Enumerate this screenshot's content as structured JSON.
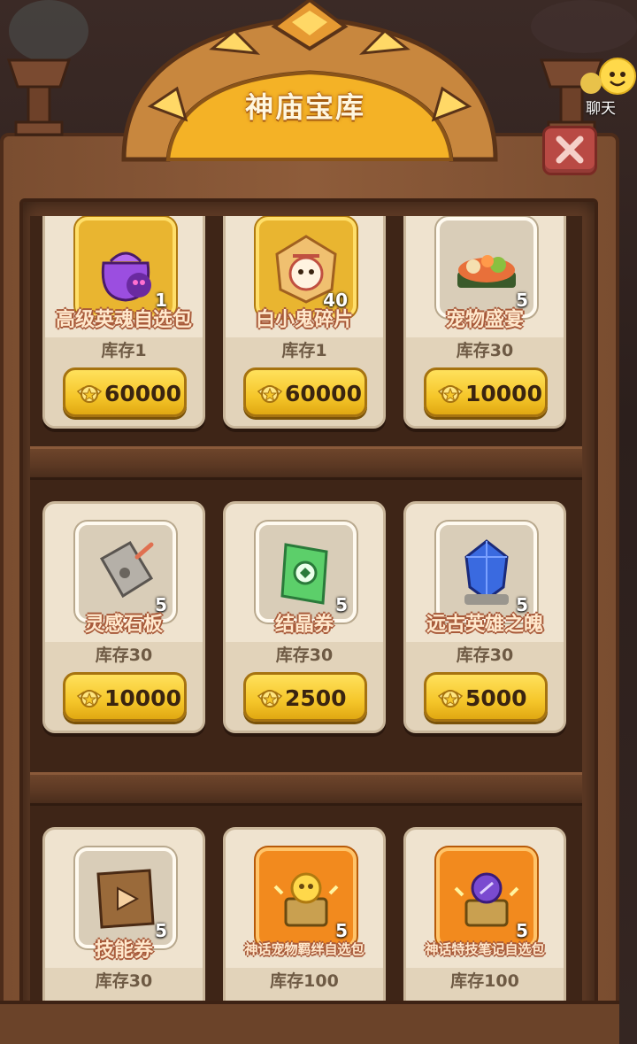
{
  "header": {
    "title": "神庙宝库"
  },
  "chat": {
    "label": "聊天"
  },
  "colors": {
    "price_button": "#f5c62a",
    "card_bg": "#efe3cf",
    "cabinet": "#7a4d30"
  },
  "items": [
    {
      "name": "高级英魂自选包",
      "stock": "库存1",
      "price": "60000",
      "qty": "1",
      "icon": "soul-bag-icon",
      "frame": "gold"
    },
    {
      "name": "白小鬼碎片",
      "stock": "库存1",
      "price": "60000",
      "qty": "40",
      "icon": "ghost-fragment-icon",
      "frame": "gold"
    },
    {
      "name": "宠物盛宴",
      "stock": "库存30",
      "price": "10000",
      "qty": "5",
      "icon": "pet-feast-icon",
      "frame": "grey"
    },
    {
      "name": "灵感石板",
      "stock": "库存30",
      "price": "10000",
      "qty": "5",
      "icon": "stone-tablet-icon",
      "frame": "grey"
    },
    {
      "name": "结晶券",
      "stock": "库存30",
      "price": "2500",
      "qty": "5",
      "icon": "crystal-ticket-icon",
      "frame": "grey"
    },
    {
      "name": "远古英雄之魄",
      "stock": "库存30",
      "price": "5000",
      "qty": "5",
      "icon": "blue-crystal-icon",
      "frame": "grey"
    },
    {
      "name": "技能券",
      "stock": "库存30",
      "price": "",
      "qty": "5",
      "icon": "skill-ticket-icon",
      "frame": "grey"
    },
    {
      "name": "神话宠物羁绊自选包",
      "stock": "库存100",
      "price": "",
      "qty": "5",
      "icon": "myth-pet-chest-icon",
      "frame": "orange"
    },
    {
      "name": "神话特技笔记自选包",
      "stock": "库存100",
      "price": "",
      "qty": "5",
      "icon": "myth-skill-chest-icon",
      "frame": "orange"
    }
  ]
}
